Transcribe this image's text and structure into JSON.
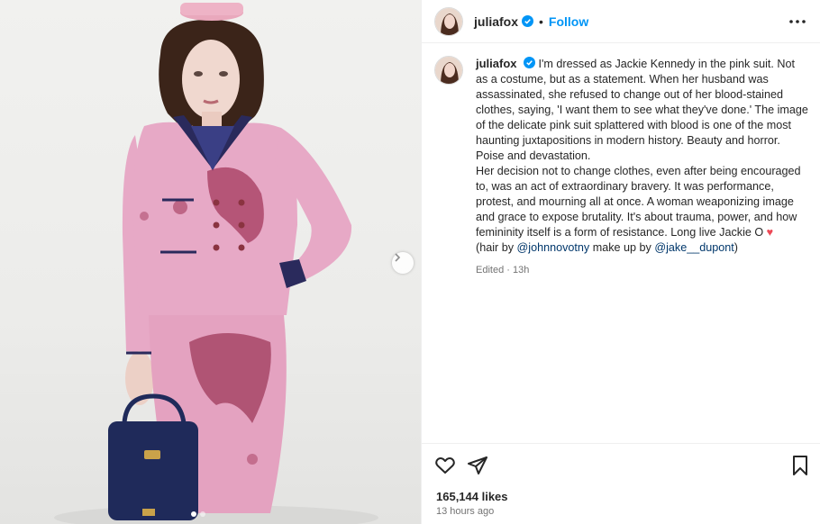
{
  "post": {
    "username": "juliafox",
    "follow_label": "Follow",
    "separator": "•",
    "caption_username": "juliafox",
    "caption_p1": "I'm dressed as Jackie Kennedy in the pink suit. Not as a costume, but as a statement. When her husband was assassinated, she refused to change out of her blood-stained clothes, saying, 'I want them to see what they've done.' The image of the delicate pink suit splattered with blood is one of the most haunting juxtapositions in modern history. Beauty and horror. Poise and devastation.",
    "caption_p2": "Her decision not to change clothes, even after being encouraged to, was an act of extraordinary bravery. It was performance, protest, and mourning all at once. A woman weaponizing image and grace to expose brutality. It's about trauma, power, and how femininity itself is a form of resistance. Long live Jackie O",
    "heart_glyph": "♥",
    "credit_prefix": "(hair by ",
    "credit_hair": "@johnnovotny",
    "credit_mid": " make up by ",
    "credit_makeup": "@jake__dupont",
    "credit_suffix": ")",
    "edited": "Edited · 13h",
    "likes": "165,144 likes",
    "time_ago": "13 hours ago"
  },
  "icons": {
    "verified": "verified-badge-icon",
    "more": "more-options-icon",
    "like": "heart-outline-icon",
    "share": "share-paper-plane-icon",
    "save": "bookmark-icon",
    "next": "chevron-right-icon"
  },
  "colors": {
    "accent_blue": "#0095f6",
    "link": "#00376b",
    "heart": "#ed4956",
    "suit_pink": "#e7a9c6"
  },
  "carousel": {
    "count": 2,
    "active": 1
  }
}
